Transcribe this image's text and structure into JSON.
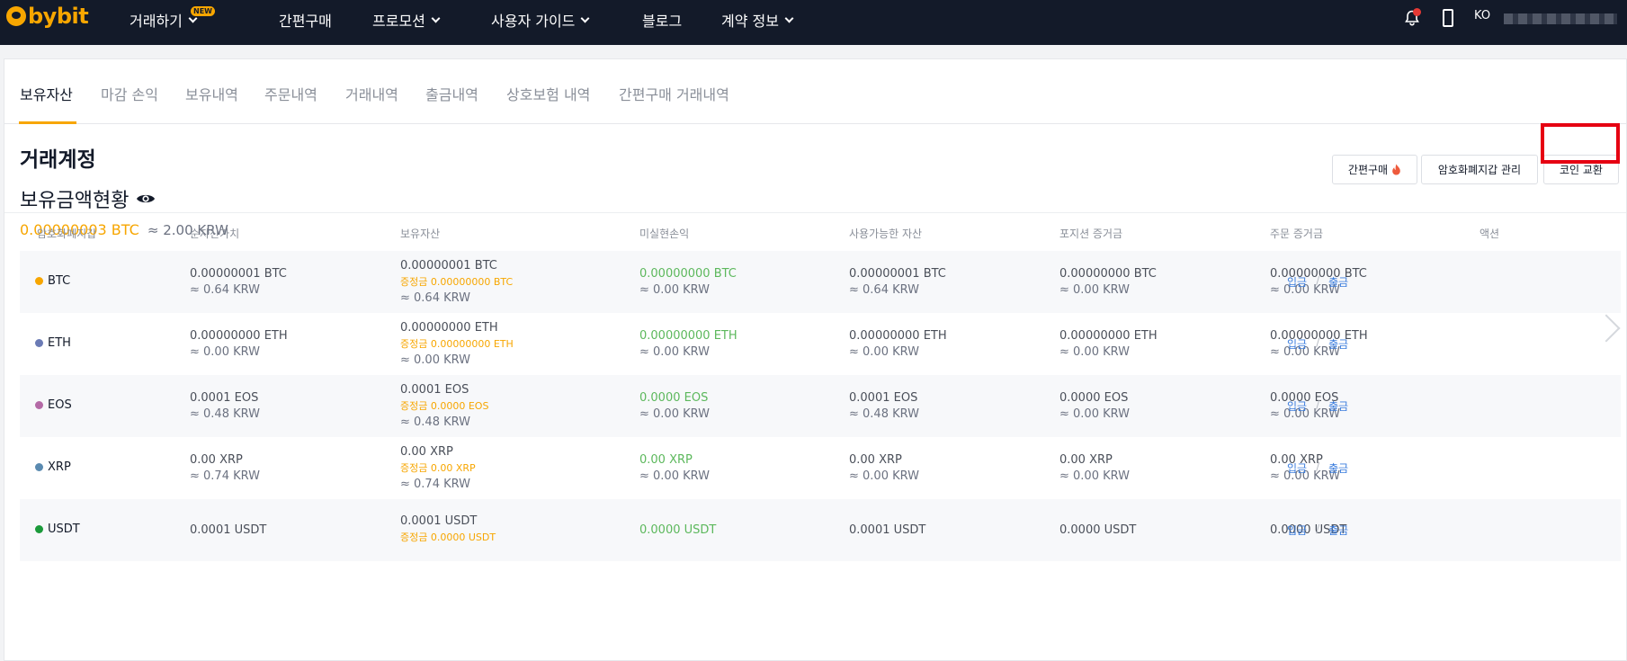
{
  "brand": {
    "name": "bybit"
  },
  "nav": {
    "items": [
      {
        "label": "거래하기",
        "has_menu": true,
        "badge": "NEW"
      },
      {
        "label": "간편구매",
        "has_menu": false
      },
      {
        "label": "프로모션",
        "has_menu": true
      },
      {
        "label": "사용자 가이드",
        "has_menu": true
      },
      {
        "label": "블로그",
        "has_menu": false
      },
      {
        "label": "계약 정보",
        "has_menu": true
      }
    ],
    "lang": "KO"
  },
  "tabs": [
    {
      "label": "보유자산",
      "active": true
    },
    {
      "label": "마감 손익"
    },
    {
      "label": "보유내역"
    },
    {
      "label": "주문내역"
    },
    {
      "label": "거래내역"
    },
    {
      "label": "출금내역"
    },
    {
      "label": "상호보험 내역"
    },
    {
      "label": "간편구매 거래내역"
    }
  ],
  "account": {
    "title": "거래계정",
    "holdings_title": "보유금액현황",
    "balance_btc": "0.00000003 BTC",
    "balance_krw": "≈ 2.00 KRW"
  },
  "buttons": {
    "quick_buy": "간편구매",
    "wallet_manage": "암호화폐지갑 관리",
    "coin_exchange": "코인 교환"
  },
  "table": {
    "headers": [
      "암호화폐지갑",
      "순자산가치",
      "보유자산",
      "미실현손익",
      "사용가능한 자산",
      "포지션 증거금",
      "주문 증거금",
      "액션"
    ],
    "rows": [
      {
        "coin": "BTC",
        "color": "#f7a600",
        "equity": "0.00000001 BTC",
        "equity_krw": "≈ 0.64 KRW",
        "wallet": "0.00000001 BTC",
        "wallet_margin": "증정금 0.00000000 BTC",
        "wallet_krw": "≈ 0.64 KRW",
        "pnl": "0.00000000 BTC",
        "pnl_krw": "≈ 0.00 KRW",
        "available": "0.00000001 BTC",
        "available_krw": "≈ 0.64 KRW",
        "position_margin": "0.00000000 BTC",
        "position_margin_krw": "≈ 0.00 KRW",
        "order_margin": "0.00000000 BTC",
        "order_margin_krw": "≈ 0.00 KRW"
      },
      {
        "coin": "ETH",
        "color": "#6b7bb5",
        "equity": "0.00000000 ETH",
        "equity_krw": "≈ 0.00 KRW",
        "wallet": "0.00000000 ETH",
        "wallet_margin": "증정금 0.00000000 ETH",
        "wallet_krw": "≈ 0.00 KRW",
        "pnl": "0.00000000 ETH",
        "pnl_krw": "≈ 0.00 KRW",
        "available": "0.00000000 ETH",
        "available_krw": "≈ 0.00 KRW",
        "position_margin": "0.00000000 ETH",
        "position_margin_krw": "≈ 0.00 KRW",
        "order_margin": "0.00000000 ETH",
        "order_margin_krw": "≈ 0.00 KRW"
      },
      {
        "coin": "EOS",
        "color": "#b46aa6",
        "equity": "0.0001 EOS",
        "equity_krw": "≈ 0.48 KRW",
        "wallet": "0.0001 EOS",
        "wallet_margin": "증정금 0.0000 EOS",
        "wallet_krw": "≈ 0.48 KRW",
        "pnl": "0.0000 EOS",
        "pnl_krw": "≈ 0.00 KRW",
        "available": "0.0001 EOS",
        "available_krw": "≈ 0.48 KRW",
        "position_margin": "0.0000 EOS",
        "position_margin_krw": "≈ 0.00 KRW",
        "order_margin": "0.0000 EOS",
        "order_margin_krw": "≈ 0.00 KRW"
      },
      {
        "coin": "XRP",
        "color": "#5a8ab0",
        "equity": "0.00 XRP",
        "equity_krw": "≈ 0.74 KRW",
        "wallet": "0.00 XRP",
        "wallet_margin": "증정금 0.00 XRP",
        "wallet_krw": "≈ 0.74 KRW",
        "pnl": "0.00 XRP",
        "pnl_krw": "≈ 0.00 KRW",
        "available": "0.00 XRP",
        "available_krw": "≈ 0.00 KRW",
        "position_margin": "0.00 XRP",
        "position_margin_krw": "≈ 0.00 KRW",
        "order_margin": "0.00 XRP",
        "order_margin_krw": "≈ 0.00 KRW"
      },
      {
        "coin": "USDT",
        "color": "#1b9a3a",
        "equity": "0.0001 USDT",
        "equity_krw": "",
        "wallet": "0.0001 USDT",
        "wallet_margin": "증정금 0.0000 USDT",
        "wallet_krw": "",
        "pnl": "0.0000 USDT",
        "pnl_krw": "",
        "available": "0.0001 USDT",
        "available_krw": "",
        "position_margin": "0.0000 USDT",
        "position_margin_krw": "",
        "order_margin": "0.0000 USDT",
        "order_margin_krw": ""
      }
    ],
    "action_deposit": "입금",
    "action_separator": "/",
    "action_withdraw": "출금"
  }
}
